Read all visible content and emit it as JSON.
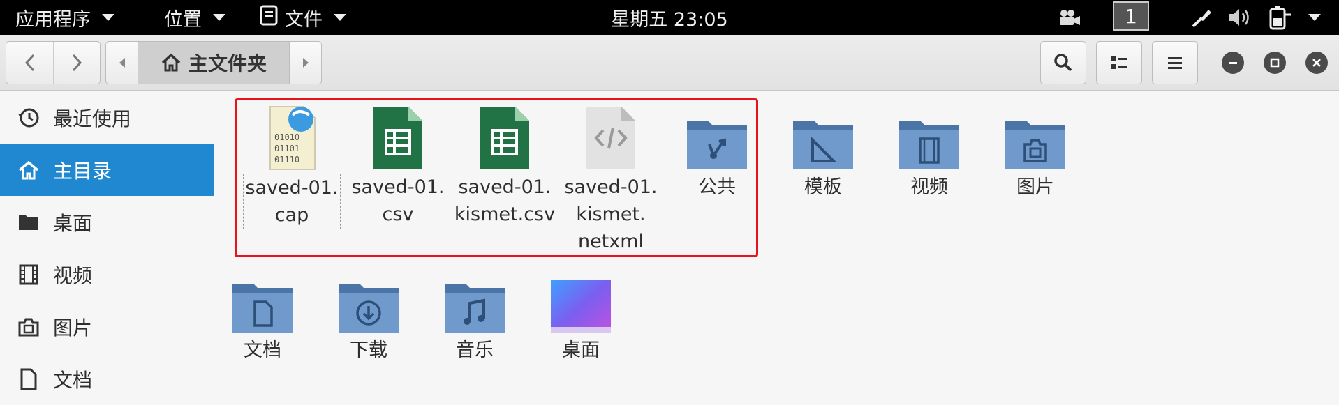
{
  "topbar": {
    "apps_menu": "应用程序",
    "places_menu": "位置",
    "file_menu": "文件",
    "clock": "星期五 23:05",
    "workspace": "1"
  },
  "header": {
    "breadcrumb": "主文件夹"
  },
  "sidebar": {
    "items": [
      {
        "label": "最近使用",
        "icon": "clock-icon"
      },
      {
        "label": "主目录",
        "icon": "home-icon",
        "active": true
      },
      {
        "label": "桌面",
        "icon": "folder-icon"
      },
      {
        "label": "视频",
        "icon": "film-icon"
      },
      {
        "label": "图片",
        "icon": "camera-icon"
      },
      {
        "label": "文档",
        "icon": "document-icon"
      }
    ]
  },
  "files": [
    {
      "name": "saved-01.cap",
      "lines": [
        "saved-01.",
        "cap"
      ],
      "type": "binary-file"
    },
    {
      "name": "saved-01.csv",
      "lines": [
        "saved-01.",
        "csv"
      ],
      "type": "spreadsheet"
    },
    {
      "name": "saved-01.kismet.csv",
      "lines": [
        "saved-01.",
        "kismet.csv"
      ],
      "type": "spreadsheet"
    },
    {
      "name": "saved-01.kismet.netxml",
      "lines": [
        "saved-01.",
        "kismet.",
        "netxml"
      ],
      "type": "xml"
    },
    {
      "name": "公共",
      "lines": [
        "公共"
      ],
      "type": "folder-share"
    },
    {
      "name": "模板",
      "lines": [
        "模板"
      ],
      "type": "folder-templates"
    },
    {
      "name": "视频",
      "lines": [
        "视频"
      ],
      "type": "folder-video"
    },
    {
      "name": "图片",
      "lines": [
        "图片"
      ],
      "type": "folder-pictures"
    },
    {
      "name": "文档",
      "lines": [
        "文档"
      ],
      "type": "folder-documents"
    },
    {
      "name": "下载",
      "lines": [
        "下载"
      ],
      "type": "folder-download"
    },
    {
      "name": "音乐",
      "lines": [
        "音乐"
      ],
      "type": "folder-music"
    },
    {
      "name": "桌面",
      "lines": [
        "桌面"
      ],
      "type": "folder-desktop"
    }
  ],
  "colors": {
    "accent": "#1f88d0",
    "highlight_border": "#e8141b",
    "folder": "#5b87b8",
    "spreadsheet": "#217346"
  }
}
